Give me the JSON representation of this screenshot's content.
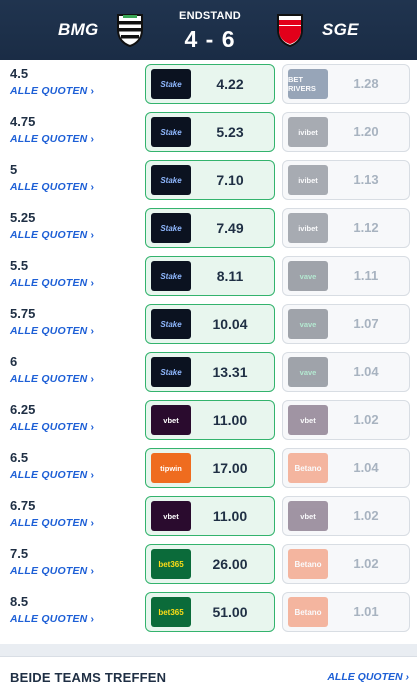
{
  "match": {
    "home_team": "BMG",
    "away_team": "SGE",
    "status": "ENDSTAND",
    "score": "4 - 6"
  },
  "all_odds_label": "ALLE QUOTEN",
  "chevron": "›",
  "rows": [
    {
      "line": "4.5",
      "best": {
        "bookie": "stake",
        "logo_text": "Stake",
        "odd": "4.22"
      },
      "other": {
        "bookie": "betrivers",
        "logo_text": "BET RIVERS",
        "odd": "1.28"
      }
    },
    {
      "line": "4.75",
      "best": {
        "bookie": "stake",
        "logo_text": "Stake",
        "odd": "5.23"
      },
      "other": {
        "bookie": "ivibet",
        "logo_text": "ivibet",
        "odd": "1.20"
      }
    },
    {
      "line": "5",
      "best": {
        "bookie": "stake",
        "logo_text": "Stake",
        "odd": "7.10"
      },
      "other": {
        "bookie": "ivibet",
        "logo_text": "ivibet",
        "odd": "1.13"
      }
    },
    {
      "line": "5.25",
      "best": {
        "bookie": "stake",
        "logo_text": "Stake",
        "odd": "7.49"
      },
      "other": {
        "bookie": "ivibet",
        "logo_text": "ivibet",
        "odd": "1.12"
      }
    },
    {
      "line": "5.5",
      "best": {
        "bookie": "stake",
        "logo_text": "Stake",
        "odd": "8.11"
      },
      "other": {
        "bookie": "vave",
        "logo_text": "vave",
        "odd": "1.11"
      }
    },
    {
      "line": "5.75",
      "best": {
        "bookie": "stake",
        "logo_text": "Stake",
        "odd": "10.04"
      },
      "other": {
        "bookie": "vave",
        "logo_text": "vave",
        "odd": "1.07"
      }
    },
    {
      "line": "6",
      "best": {
        "bookie": "stake",
        "logo_text": "Stake",
        "odd": "13.31"
      },
      "other": {
        "bookie": "vave",
        "logo_text": "vave",
        "odd": "1.04"
      }
    },
    {
      "line": "6.25",
      "best": {
        "bookie": "vbet",
        "logo_text": "vbet",
        "odd": "11.00"
      },
      "other": {
        "bookie": "vbet",
        "logo_text": "vbet",
        "odd": "1.02"
      }
    },
    {
      "line": "6.5",
      "best": {
        "bookie": "tipwin",
        "logo_text": "tipwin",
        "odd": "17.00"
      },
      "other": {
        "bookie": "betano",
        "logo_text": "Betano",
        "odd": "1.04"
      }
    },
    {
      "line": "6.75",
      "best": {
        "bookie": "vbet",
        "logo_text": "vbet",
        "odd": "11.00"
      },
      "other": {
        "bookie": "vbet",
        "logo_text": "vbet",
        "odd": "1.02"
      }
    },
    {
      "line": "7.5",
      "best": {
        "bookie": "bet365",
        "logo_text": "bet365",
        "odd": "26.00"
      },
      "other": {
        "bookie": "betano",
        "logo_text": "Betano",
        "odd": "1.02"
      }
    },
    {
      "line": "8.5",
      "best": {
        "bookie": "bet365",
        "logo_text": "bet365",
        "odd": "51.00"
      },
      "other": {
        "bookie": "betano",
        "logo_text": "Betano",
        "odd": "1.01"
      }
    }
  ],
  "next_market": {
    "title": "BEIDE TEAMS TREFFEN",
    "link": "ALLE QUOTEN"
  },
  "colors": {
    "header_bg": "#1a2c45",
    "best_border": "#33b36d",
    "best_bg": "#e8f6ee",
    "link": "#1d5fd6"
  }
}
